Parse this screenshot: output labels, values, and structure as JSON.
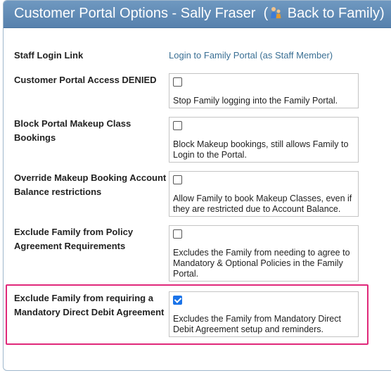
{
  "header": {
    "title": "Customer Portal Options - Sally Fraser",
    "back_open": "(",
    "back_label": "Back to Family)"
  },
  "staff_login": {
    "label": "Staff Login Link",
    "link": "Login to Family Portal (as Staff Member)"
  },
  "options": [
    {
      "label": "Customer Portal Access DENIED",
      "description": "Stop Family logging into the Family Portal.",
      "checked": false
    },
    {
      "label": "Block Portal Makeup Class Bookings",
      "description": "Block Makeup bookings, still allows Family to Login to the Portal.",
      "checked": false
    },
    {
      "label": "Override Makeup Booking Account Balance restrictions",
      "description": "Allow Family to book Makeup Classes, even if they are restricted due to Account Balance.",
      "checked": false
    },
    {
      "label": "Exclude Family from Policy Agreement Requirements",
      "description": "Excludes the Family from needing to agree to Mandatory & Optional Policies in the Family Portal.",
      "checked": false
    },
    {
      "label": "Exclude Family from requiring a Mandatory Direct Debit Agreement",
      "description": "Excludes the Family from Mandatory Direct Debit Agreement setup and reminders.",
      "checked": true
    }
  ],
  "colors": {
    "header_bg": "#5f8ab5",
    "link": "#3a6f94",
    "highlight": "#e0287a",
    "checkbox_checked": "#1a73e8"
  }
}
